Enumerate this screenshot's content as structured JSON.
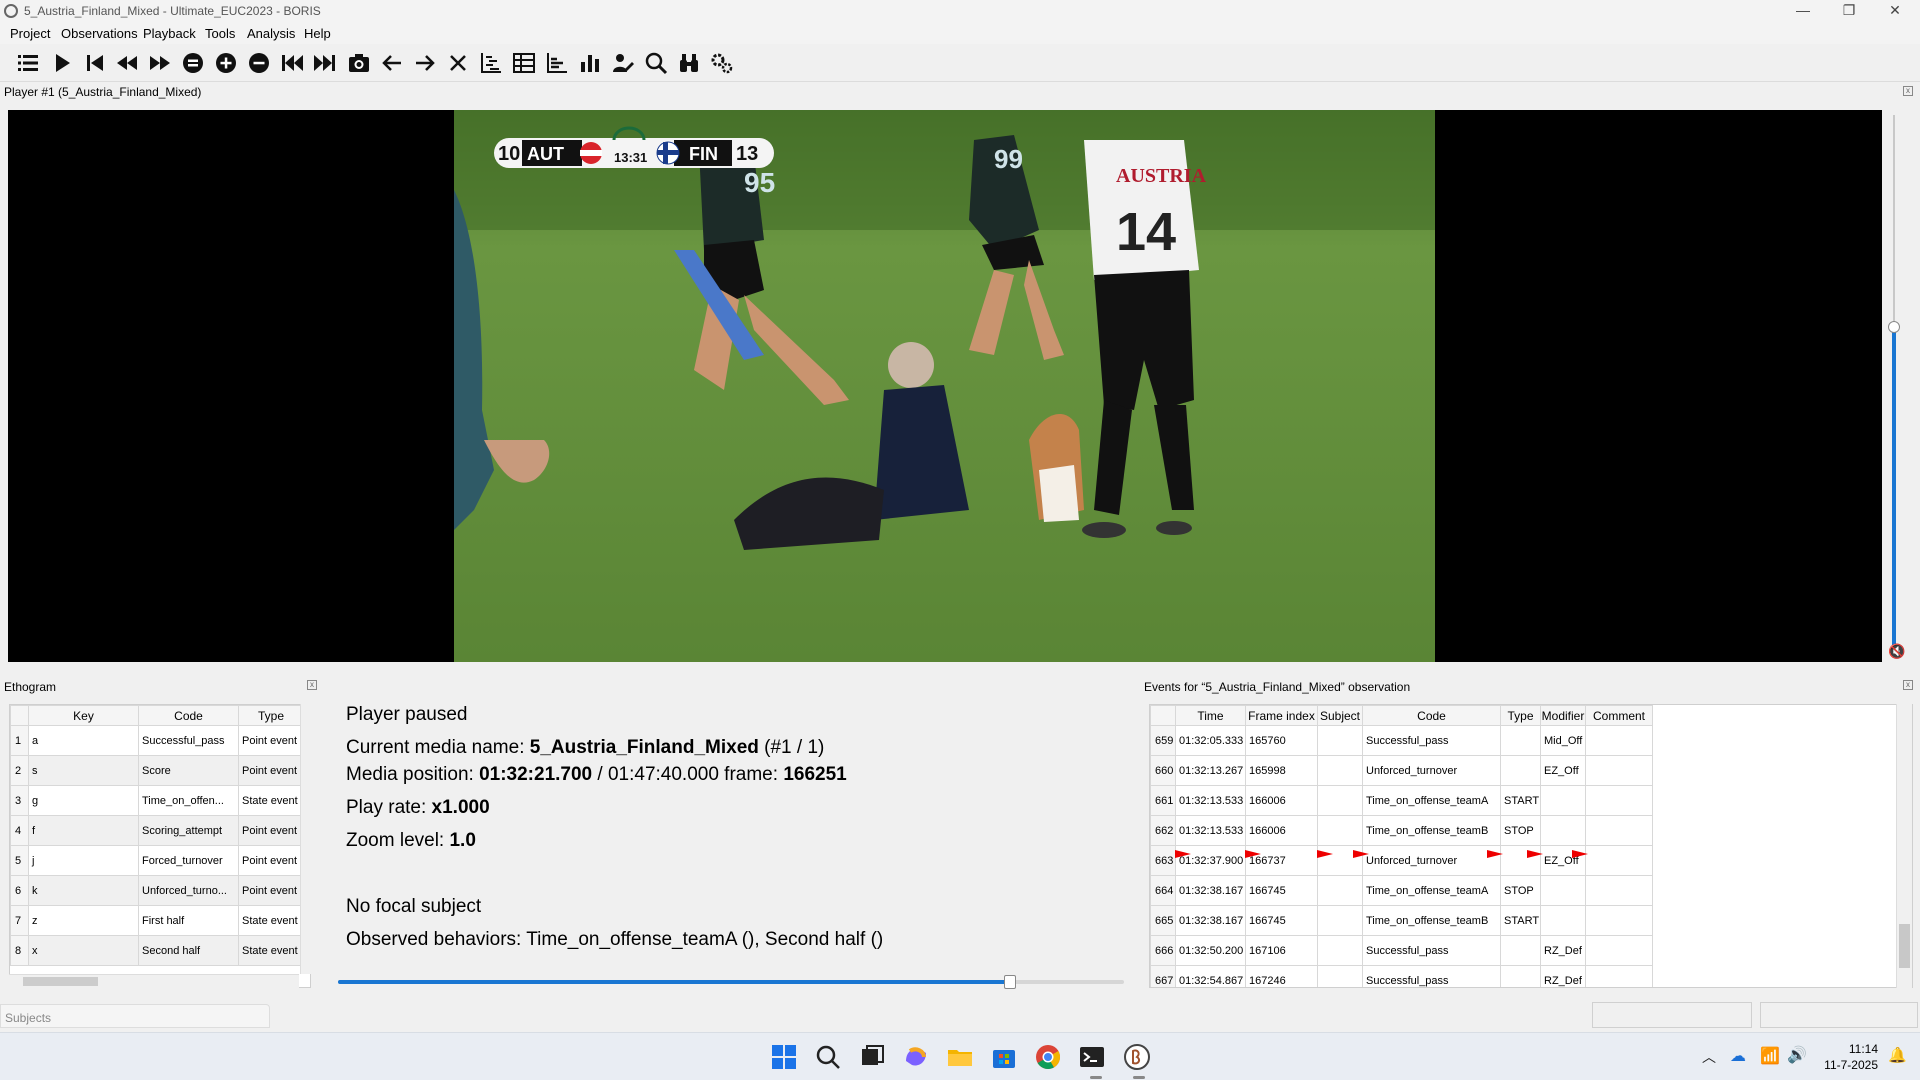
{
  "window": {
    "title": "5_Austria_Finland_Mixed - Ultimate_EUC2023 - BORIS",
    "minimize": "—",
    "restore": "❐",
    "close": "✕"
  },
  "menu": [
    "Project",
    "Observations",
    "Playback",
    "Tools",
    "Analysis",
    "Help"
  ],
  "toolbar_icons": [
    "list-icon",
    "play-icon",
    "previous-media-icon",
    "rewind-icon",
    "fast-forward-icon",
    "reset-speed-icon",
    "speed-up-icon",
    "slow-down-icon",
    "jump-start-icon",
    "jump-end-icon",
    "snapshot-icon",
    "frame-back-icon",
    "frame-forward-icon",
    "close-media-icon",
    "plot-events-icon",
    "table-icon",
    "plot-icon",
    "bar-chart-icon",
    "edit-events-icon",
    "find-icon",
    "find-replace-icon",
    "settings-icon"
  ],
  "player": {
    "label": "Player #1 (5_Austria_Finland_Mixed)",
    "volume_level": 0.6,
    "scoreboard": {
      "home_score": "10",
      "home_team": "AUT",
      "clock": "13:31",
      "away_team": "FIN",
      "away_score": "13"
    },
    "jerseys": {
      "back_number_1": "95",
      "back_number_2": "99",
      "shirt_text": "AUSTRIA",
      "shirt_number": "14"
    }
  },
  "ethogram": {
    "title": "Ethogram",
    "columns": [
      "Key",
      "Code",
      "Type"
    ],
    "rows": [
      {
        "n": "1",
        "key": "a",
        "code": "Successful_pass",
        "type": "Point event"
      },
      {
        "n": "2",
        "key": "s",
        "code": "Score",
        "type": "Point event"
      },
      {
        "n": "3",
        "key": "g",
        "code": "Time_on_offen...",
        "type": "State event"
      },
      {
        "n": "4",
        "key": "f",
        "code": "Scoring_attempt",
        "type": "Point event"
      },
      {
        "n": "5",
        "key": "j",
        "code": "Forced_turnover",
        "type": "Point event"
      },
      {
        "n": "6",
        "key": "k",
        "code": "Unforced_turno...",
        "type": "Point event"
      },
      {
        "n": "7",
        "key": "z",
        "code": "First half",
        "type": "State event"
      },
      {
        "n": "8",
        "key": "x",
        "code": "Second half",
        "type": "State event"
      }
    ]
  },
  "info": {
    "status": "Player paused",
    "media_name_label": "Current media name: ",
    "media_name": "5_Austria_Finland_Mixed",
    "media_index": " (#1 / 1)",
    "position_label": "Media position: ",
    "position": "01:32:21.700",
    "duration": " / 01:47:40.000 frame: ",
    "frame": "166251",
    "play_rate_label": "Play rate: ",
    "play_rate": "x1.000",
    "zoom_label": "Zoom level: ",
    "zoom": "1.0",
    "focal": "No focal subject",
    "observed": "Observed behaviors: Time_on_offense_teamA (), Second half ()",
    "slider_fraction": 0.855
  },
  "events": {
    "title": "Events for “5_Austria_Finland_Mixed” observation",
    "columns": [
      "Time",
      "Frame index",
      "Subject",
      "Code",
      "Type",
      "Modifier",
      "Comment"
    ],
    "rows": [
      {
        "n": "659",
        "time": "01:32:05.333",
        "frame": "165760",
        "subject": "",
        "code": "Successful_pass",
        "type": "",
        "modifier": "Mid_Off",
        "comment": ""
      },
      {
        "n": "660",
        "time": "01:32:13.267",
        "frame": "165998",
        "subject": "",
        "code": "Unforced_turnover",
        "type": "",
        "modifier": "EZ_Off",
        "comment": ""
      },
      {
        "n": "661",
        "time": "01:32:13.533",
        "frame": "166006",
        "subject": "",
        "code": "Time_on_offense_teamA",
        "type": "START",
        "modifier": "",
        "comment": ""
      },
      {
        "n": "662",
        "time": "01:32:13.533",
        "frame": "166006",
        "subject": "",
        "code": "Time_on_offense_teamB",
        "type": "STOP",
        "modifier": "",
        "comment": ""
      },
      {
        "n": "663",
        "time": "01:32:37.900",
        "frame": "166737",
        "subject": "",
        "code": "Unforced_turnover",
        "type": "",
        "modifier": "EZ_Off",
        "comment": ""
      },
      {
        "n": "664",
        "time": "01:32:38.167",
        "frame": "166745",
        "subject": "",
        "code": "Time_on_offense_teamA",
        "type": "STOP",
        "modifier": "",
        "comment": ""
      },
      {
        "n": "665",
        "time": "01:32:38.167",
        "frame": "166745",
        "subject": "",
        "code": "Time_on_offense_teamB",
        "type": "START",
        "modifier": "",
        "comment": ""
      },
      {
        "n": "666",
        "time": "01:32:50.200",
        "frame": "167106",
        "subject": "",
        "code": "Successful_pass",
        "type": "",
        "modifier": "RZ_Def",
        "comment": ""
      },
      {
        "n": "667",
        "time": "01:32:54.867",
        "frame": "167246",
        "subject": "",
        "code": "Successful_pass",
        "type": "",
        "modifier": "RZ_Def",
        "comment": ""
      }
    ]
  },
  "subjects": {
    "title": "Subjects"
  },
  "taskbar": {
    "icons": [
      "windows-start-icon",
      "search-icon",
      "task-view-icon",
      "copilot-icon",
      "file-explorer-icon",
      "store-icon",
      "chrome-icon",
      "terminal-icon",
      "boris-icon"
    ],
    "time": "11:14",
    "date": "11-7-2025"
  }
}
